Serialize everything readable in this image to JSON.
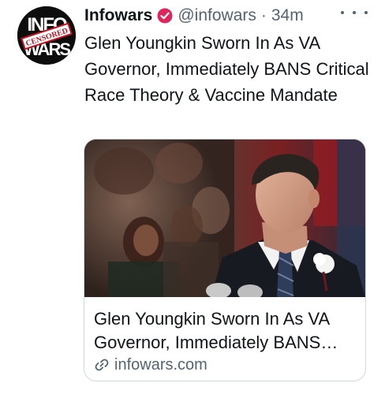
{
  "tweet": {
    "author": {
      "display_name": "Infowars",
      "handle": "@infowars",
      "verified_icon": "verified-badge-icon",
      "avatar_icon": "infowars-censored-logo"
    },
    "separator": "·",
    "timestamp": "34m",
    "more_icon": "more-dots-icon",
    "text": "Glen Youngkin Sworn In As VA Governor, Immediately BANS Critical Race Theory & Vaccine Mandate",
    "card": {
      "title": "Glen Youngkin Sworn In As VA Governor, Immediately BANS Critical Race Theory & Vaccine Mandate",
      "domain": "infowars.com",
      "link_icon": "link-icon"
    }
  },
  "colors": {
    "text_primary": "#0f1419",
    "text_secondary": "#536471",
    "border": "#cfd9de",
    "badge": "#e0245e"
  }
}
